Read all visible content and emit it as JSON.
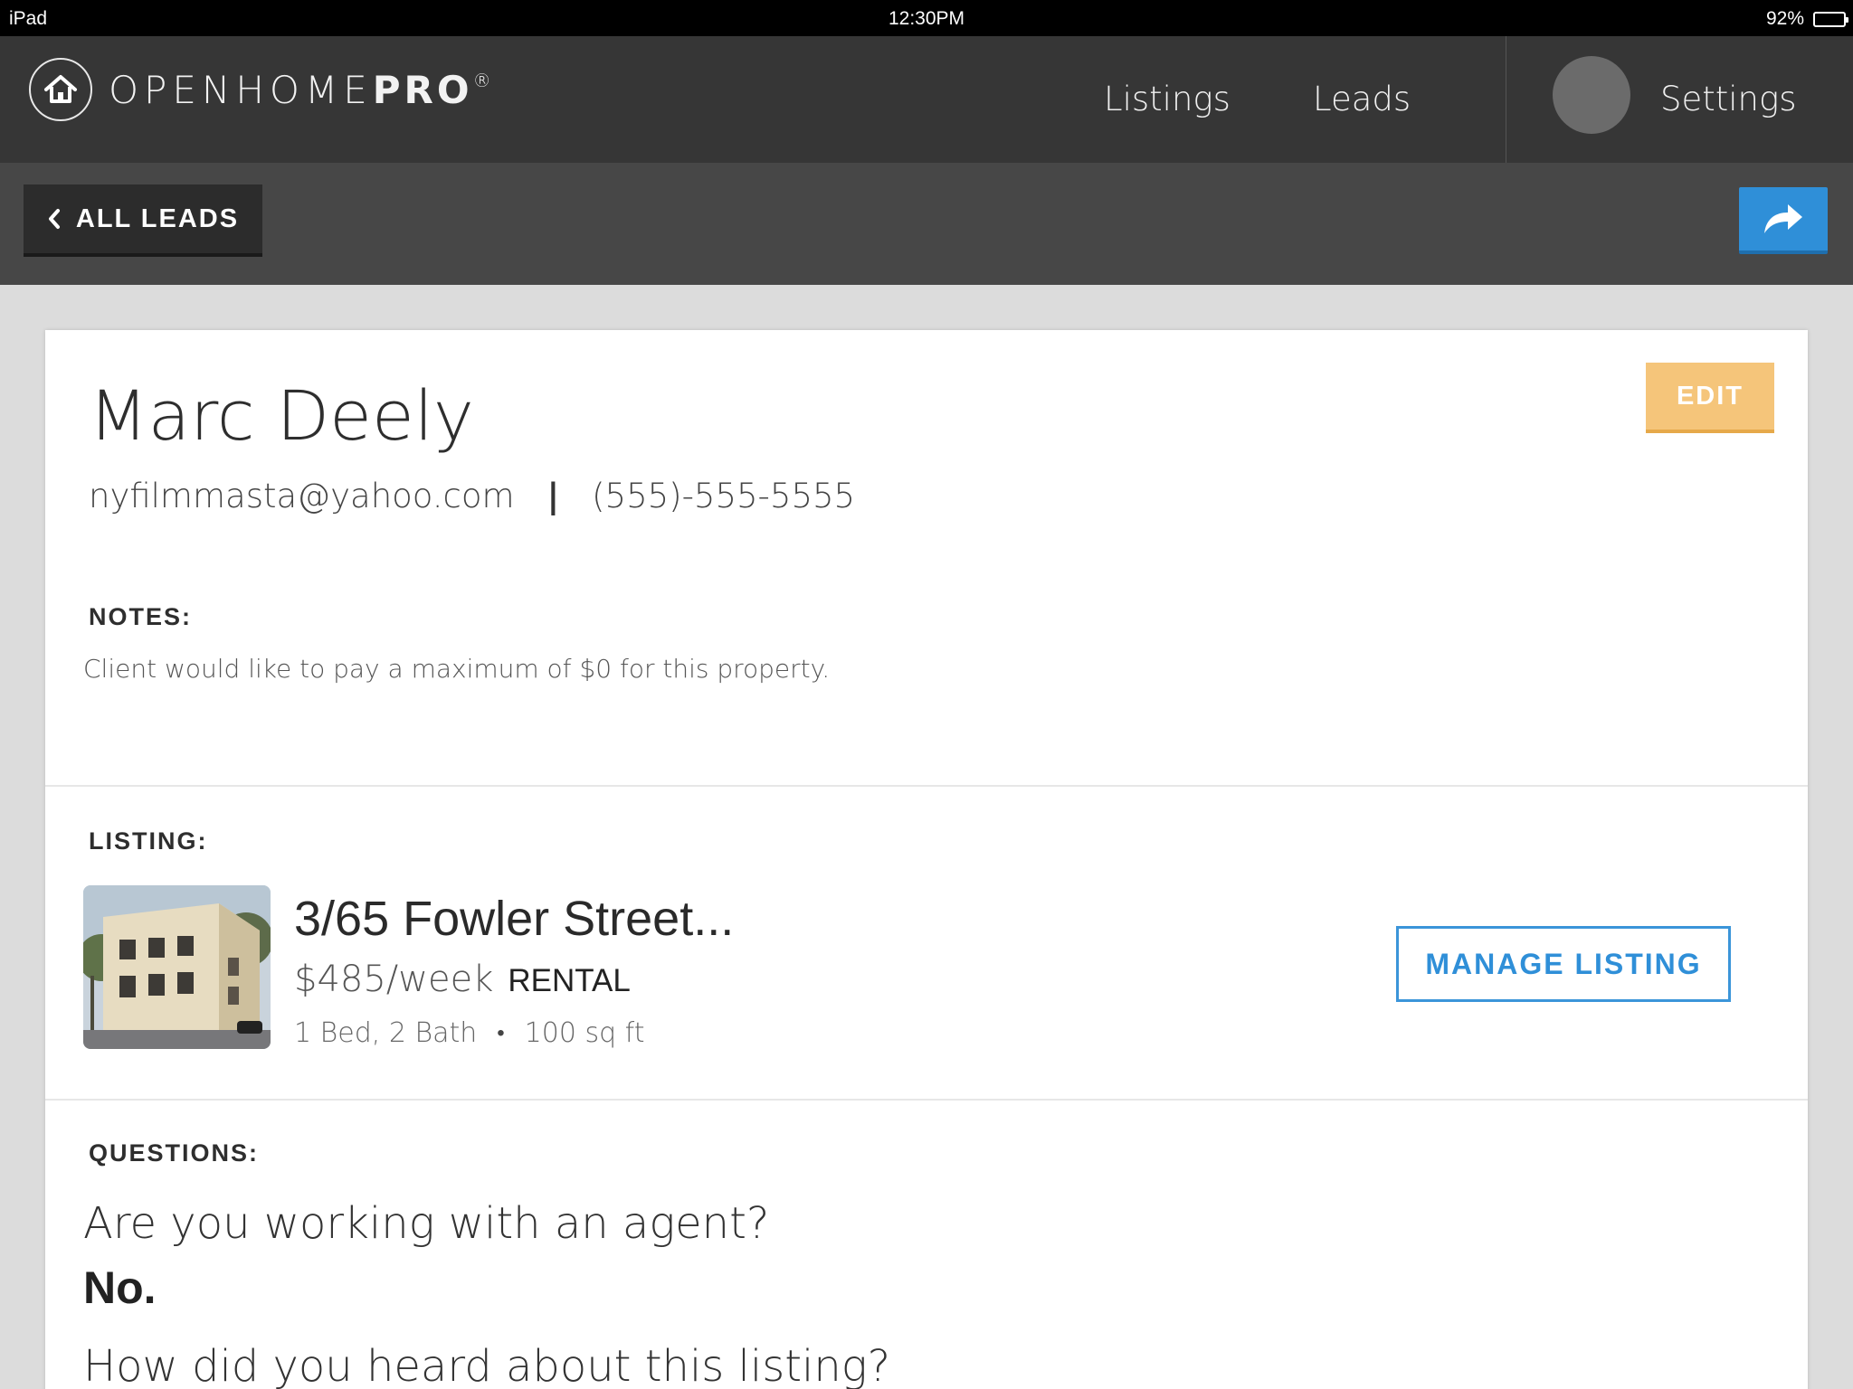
{
  "status_bar": {
    "device": "iPad",
    "time": "12:30PM",
    "battery": "92%",
    "battery_level": 0.92
  },
  "app": {
    "logo_text_light": "OPENHOME",
    "logo_text_bold": "PRO",
    "logo_mark": "®",
    "logo_icon": "house-icon"
  },
  "nav": {
    "listings": "Listings",
    "leads": "Leads",
    "settings": "Settings"
  },
  "toolbar": {
    "back_label": "ALL LEADS",
    "back_icon": "chevron-left-icon",
    "share_icon": "share-arrow-icon",
    "share_color": "#2f8fd8"
  },
  "lead": {
    "name": "Marc Deely",
    "email": "nyfilmmasta@yahoo.com",
    "separator": "|",
    "phone": "(555)-555-5555",
    "edit_label": "EDIT",
    "edit_color": "#f5c57a"
  },
  "notes": {
    "label": "NOTES:",
    "text": "Client would like to pay a maximum of $0 for this property."
  },
  "listing": {
    "label": "LISTING:",
    "address": "3/65 Fowler Street...",
    "price": "$485/week",
    "type": "RENTAL",
    "beds_baths": "1 Bed, 2 Bath",
    "bullet": "•",
    "area": "100 sq ft",
    "manage_label": "MANAGE LISTING"
  },
  "questions": {
    "label": "QUESTIONS:",
    "items": [
      {
        "question": "Are you working with an agent?",
        "answer": "No."
      },
      {
        "question": "How did you heard about this listing?",
        "answer": ""
      }
    ]
  }
}
